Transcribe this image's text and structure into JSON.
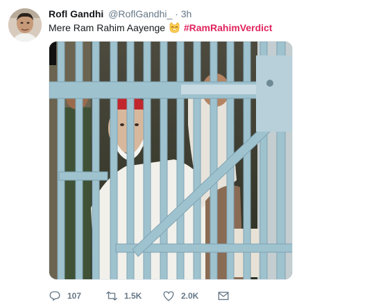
{
  "tweet": {
    "display_name": "Rofl Gandhi",
    "handle": "@RoflGandhi_",
    "separator": "·",
    "time": "3h",
    "text": "Mere Ram Rahim Aayenge",
    "emoji": "smirk-cat-emoji",
    "hashtag": "#RamRahimVerdict",
    "hashtag_color": "#e0245e"
  },
  "actions": {
    "reply_count": "107",
    "retweet_count": "1.5K",
    "like_count": "2.0K",
    "reply_icon": "reply-icon",
    "retweet_icon": "retweet-icon",
    "like_icon": "heart-icon",
    "dm_icon": "envelope-icon"
  },
  "colors": {
    "text_primary": "#14171a",
    "text_secondary": "#657786",
    "bars": "#9fc2cf"
  }
}
